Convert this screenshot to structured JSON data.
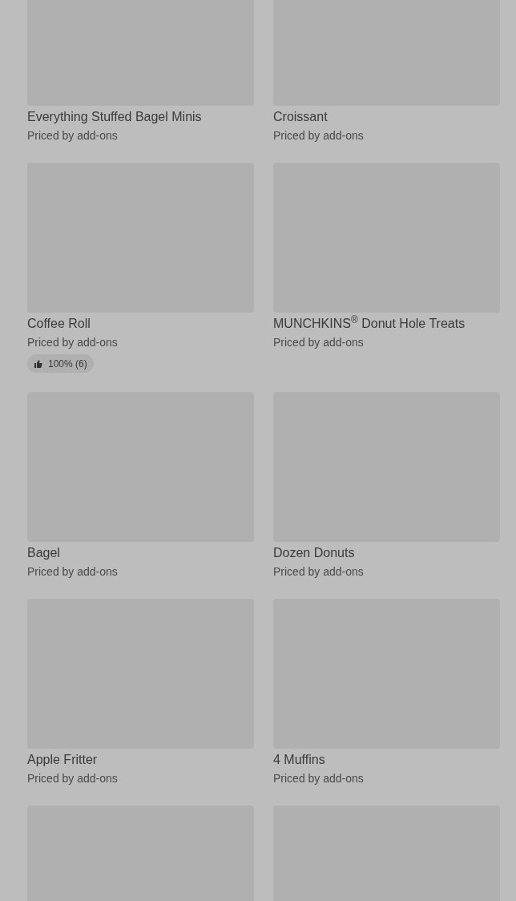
{
  "products": [
    {
      "kind": "product",
      "title": "Everything Stuffed Bagel Minis",
      "price": "Priced by add-ons"
    },
    {
      "kind": "product",
      "title": "Croissant",
      "price": "Priced by add-ons"
    },
    {
      "kind": "product",
      "title": "Coffee Roll",
      "price": "Priced by add-ons",
      "rating": "100% (6)"
    },
    {
      "kind": "product",
      "title": "MUNCHKINS$^{®}$ Donut Hole Treats",
      "price": "Priced by add-ons"
    },
    {
      "kind": "product",
      "title": "Bagel",
      "price": "Priced by add-ons"
    },
    {
      "kind": "product",
      "title": "Dozen Donuts",
      "price": "Priced by add-ons"
    },
    {
      "kind": "product",
      "title": "Apple Fritter",
      "price": "Priced by add-ons"
    },
    {
      "kind": "product",
      "title": "4 Muffins",
      "price": "Priced by add-ons"
    },
    {
      "kind": "image_only"
    },
    {
      "kind": "image_only"
    }
  ]
}
